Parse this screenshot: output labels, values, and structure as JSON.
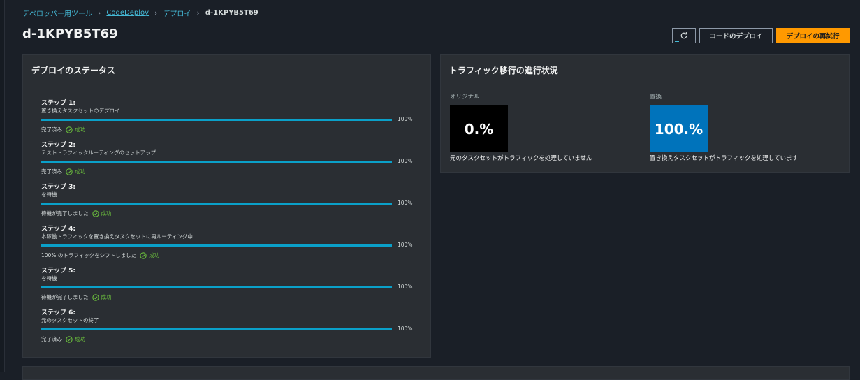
{
  "breadcrumb": {
    "items": [
      "デベロッパー用ツール",
      "CodeDeploy",
      "デプロイ"
    ],
    "current": "d-1KPYB5T69"
  },
  "page": {
    "title": "d-1KPYB5T69"
  },
  "actions": {
    "refresh_icon": "refresh-icon",
    "deploy_code": "コードのデプロイ",
    "retry_deploy": "デプロイの再試行"
  },
  "status_panel": {
    "title": "デプロイのステータス",
    "steps": [
      {
        "title": "ステップ 1:",
        "desc": "置き換えタスクセットのデプロイ",
        "progress": 1.0,
        "percent": "100%",
        "status": "完了済み",
        "result": "成功"
      },
      {
        "title": "ステップ 2:",
        "desc": "テストトラフィックルーティングのセットアップ",
        "progress": 1.0,
        "percent": "100%",
        "status": "完了済み",
        "result": "成功"
      },
      {
        "title": "ステップ 3:",
        "desc": "を待機",
        "progress": 1.0,
        "percent": "100%",
        "status": "待機が完了しました",
        "result": "成功"
      },
      {
        "title": "ステップ 4:",
        "desc": "本稼働トラフィックを置き換えタスクセットに再ルーティング中",
        "progress": 1.0,
        "percent": "100%",
        "status": "100% のトラフィックをシフトしました",
        "result": "成功"
      },
      {
        "title": "ステップ 5:",
        "desc": "を待機",
        "progress": 1.0,
        "percent": "100%",
        "status": "待機が完了しました",
        "result": "成功"
      },
      {
        "title": "ステップ 6:",
        "desc": "元のタスクセットの終了",
        "progress": 1.0,
        "percent": "100%",
        "status": "完了済み",
        "result": "成功"
      }
    ]
  },
  "traffic_panel": {
    "title": "トラフィック移行の進行状況",
    "original": {
      "label": "オリジナル",
      "value": "0.%",
      "note": "元のタスクセットがトラフィックを処理していません"
    },
    "replacement": {
      "label": "置換",
      "value": "100.%",
      "note": "置き換えタスクセットがトラフィックを処理しています"
    }
  },
  "colors": {
    "accent_link": "#44b9d6",
    "progress": "#0aa0c9",
    "success": "#6bbf3d",
    "primary_button": "#ff9900",
    "replacement_box": "#0073bb"
  }
}
